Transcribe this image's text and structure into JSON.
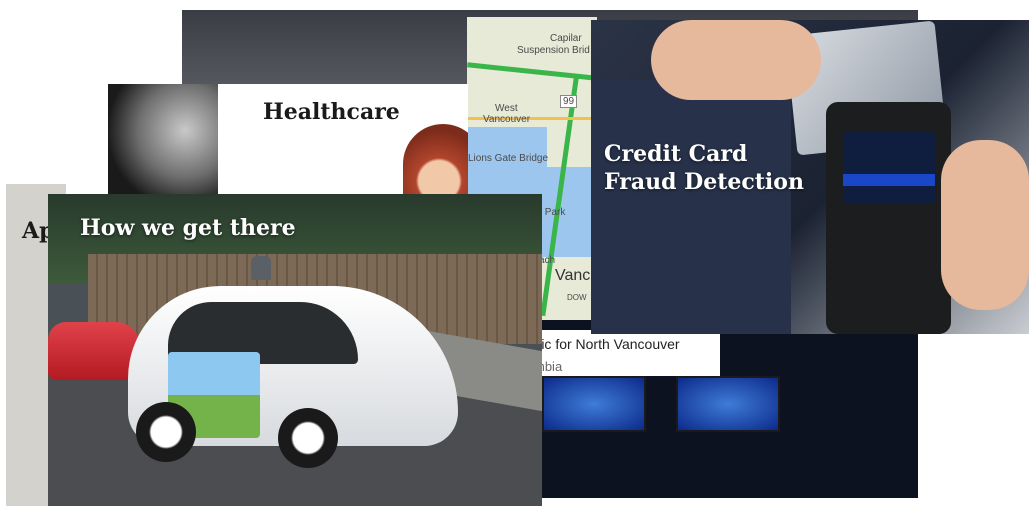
{
  "cards": {
    "healthcare": {
      "title": "Healthcare"
    },
    "credit_card": {
      "title": "Credit Card\nFraud Detection"
    },
    "apps": {
      "title": "Ap"
    },
    "car": {
      "title": "How we get there"
    },
    "map": {
      "labels": {
        "capilano": "Capilar",
        "suspension": "Suspension Brid",
        "west": "West",
        "vancouver": "Vancouver",
        "lions_gate": "Lions Gate Bridge",
        "hwy": "99",
        "park": "y Park",
        "vanc": "Vanc",
        "ach": "ach",
        "dow": "DOW"
      },
      "footer_title": "affic for North Vancouver",
      "footer_sub": "mbia"
    }
  }
}
